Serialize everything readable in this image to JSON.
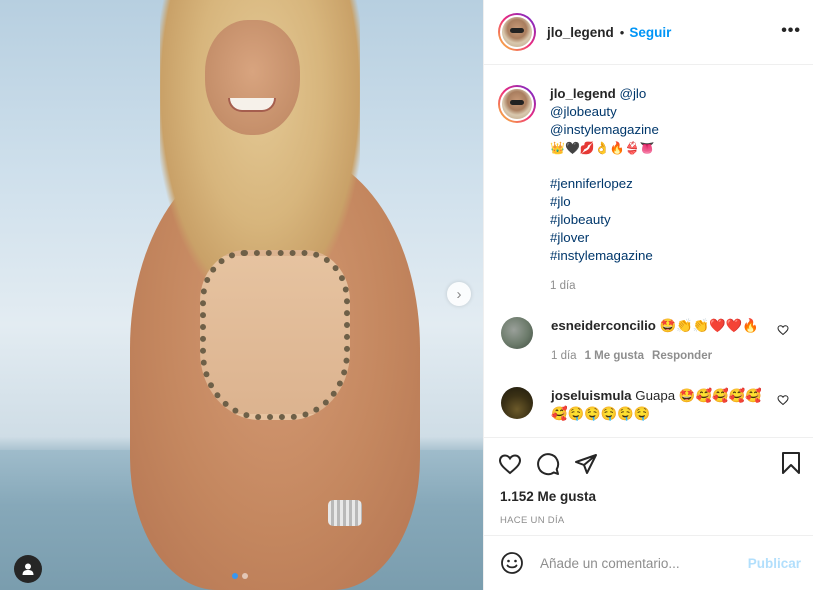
{
  "header": {
    "username": "jlo_legend",
    "separator": "•",
    "follow_label": "Seguir",
    "more_label": "•••"
  },
  "caption": {
    "username": "jlo_legend",
    "mention_main": "@jlo",
    "mentions": [
      "@jlobeauty",
      "@instylemagazine"
    ],
    "emojis": "👑🖤💋👌🔥👙👅",
    "hashtags": [
      "#jenniferlopez",
      "#jlo",
      "#jlobeauty",
      "#jlover",
      "#instylemagazine"
    ],
    "time": "1 día"
  },
  "comments": [
    {
      "username": "esneiderconcilio",
      "text": "🤩👏👏❤️❤️🔥",
      "time": "1 día",
      "likes": "1 Me gusta",
      "reply": "Responder"
    },
    {
      "username": "joseluismula",
      "text": "Guapa 🤩🥰🥰🥰🥰🥰🤤🤤🤤🤤🤤",
      "time": "",
      "likes": "",
      "reply": ""
    }
  ],
  "post": {
    "likes": "1.152 Me gusta",
    "date": "HACE UN DÍA"
  },
  "composer": {
    "placeholder": "Añade un comentario...",
    "publish_label": "Publicar"
  },
  "carousel": {
    "next_label": "›",
    "dot_count": 2,
    "active_index": 0
  },
  "colors": {
    "accent": "#0095f6",
    "link": "#00376b",
    "muted": "#8e8e8e",
    "publish_disabled": "#b2dffc"
  },
  "icons": {
    "like": "heart-icon",
    "comment": "comment-icon",
    "share": "share-icon",
    "save": "bookmark-icon",
    "emoji": "emoji-icon",
    "user_tag": "user-icon",
    "comment_like": "heart-icon"
  }
}
